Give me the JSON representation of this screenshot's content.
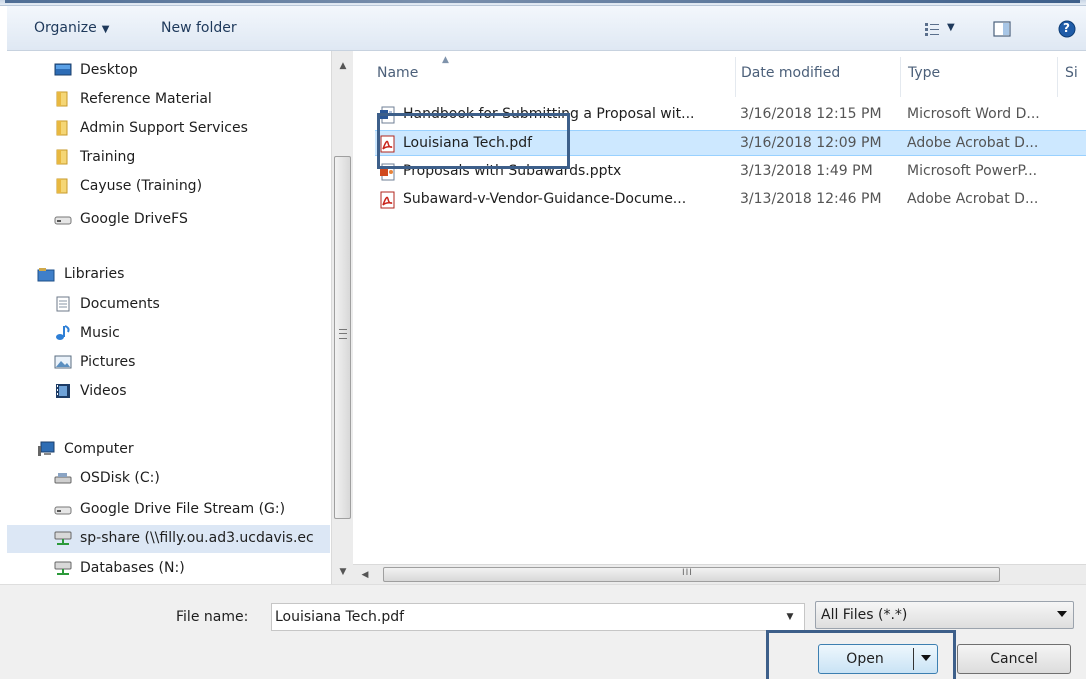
{
  "toolbar": {
    "organize_label": "Organize",
    "organize_caret": "▼",
    "new_folder_label": "New folder",
    "views_caret": "▼",
    "help_glyph": "?"
  },
  "nav": {
    "favorites": [
      {
        "label": "Desktop",
        "icon": "desktop-icon"
      },
      {
        "label": "Reference Material",
        "icon": "folder-icon"
      },
      {
        "label": "Admin Support Services",
        "icon": "folder-icon"
      },
      {
        "label": "Training",
        "icon": "folder-icon"
      },
      {
        "label": "Cayuse (Training)",
        "icon": "folder-icon"
      },
      {
        "label": "Google DriveFS",
        "icon": "drive-icon"
      }
    ],
    "libraries_label": "Libraries",
    "libraries": [
      {
        "label": "Documents",
        "icon": "documents-icon"
      },
      {
        "label": "Music",
        "icon": "music-icon"
      },
      {
        "label": "Pictures",
        "icon": "pictures-icon"
      },
      {
        "label": "Videos",
        "icon": "videos-icon"
      }
    ],
    "computer_label": "Computer",
    "computer": [
      {
        "label": "OSDisk (C:)",
        "icon": "disk-icon"
      },
      {
        "label": "Google Drive File Stream (G:)",
        "icon": "drive-icon"
      },
      {
        "label": "sp-share (\\\\filly.ou.ad3.ucdavis.ec",
        "icon": "network-drive-icon",
        "selected": true
      },
      {
        "label": "Databases (N:)",
        "icon": "network-drive-icon"
      }
    ]
  },
  "files": {
    "columns": {
      "name": "Name",
      "date": "Date modified",
      "type": "Type",
      "size": "Si"
    },
    "rows": [
      {
        "name": "Handbook for Submitting a Proposal wit...",
        "date": "3/16/2018 12:15 PM",
        "type": "Microsoft Word D...",
        "icon": "word-doc-icon"
      },
      {
        "name": "Louisiana Tech.pdf",
        "date": "3/16/2018 12:09 PM",
        "type": "Adobe Acrobat D...",
        "icon": "pdf-icon",
        "selected": true
      },
      {
        "name": "Proposals with Subawards.pptx",
        "date": "3/13/2018 1:49 PM",
        "type": "Microsoft PowerP...",
        "icon": "powerpoint-icon"
      },
      {
        "name": "Subaward-v-Vendor-Guidance-Docume...",
        "date": "3/13/2018 12:46 PM",
        "type": "Adobe Acrobat D...",
        "icon": "pdf-icon"
      }
    ],
    "hscroll_grip": "III"
  },
  "bottom": {
    "file_name_label": "File name:",
    "file_name_value": "Louisiana Tech.pdf",
    "filter_value": "All Files (*.*)",
    "open_label": "Open",
    "cancel_label": "Cancel"
  },
  "colors": {
    "accent_border": "#3d5f8a",
    "selection": "#cde8ff",
    "toolbar_text": "#1e395b"
  }
}
